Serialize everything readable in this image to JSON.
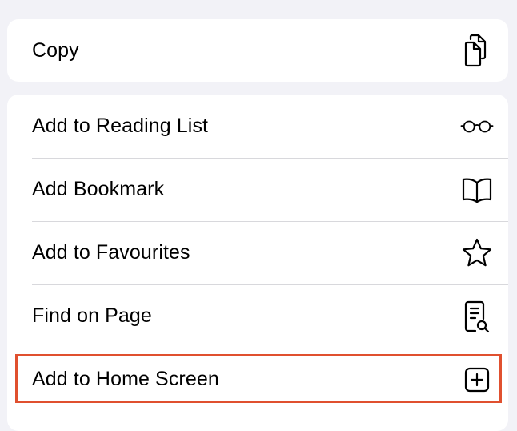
{
  "copy_section": {
    "label": "Copy",
    "icon": "copy-icon"
  },
  "actions": [
    {
      "label": "Add to Reading List",
      "icon": "glasses-icon"
    },
    {
      "label": "Add Bookmark",
      "icon": "book-icon"
    },
    {
      "label": "Add to Favourites",
      "icon": "star-icon"
    },
    {
      "label": "Find on Page",
      "icon": "find-on-page-icon"
    },
    {
      "label": "Add to Home Screen",
      "icon": "add-square-icon"
    }
  ],
  "highlight": {
    "target": "Add to Home Screen",
    "color": "#e0502f"
  },
  "colors": {
    "background": "#f2f2f7",
    "card": "#ffffff",
    "separator": "#d8d8dc"
  }
}
